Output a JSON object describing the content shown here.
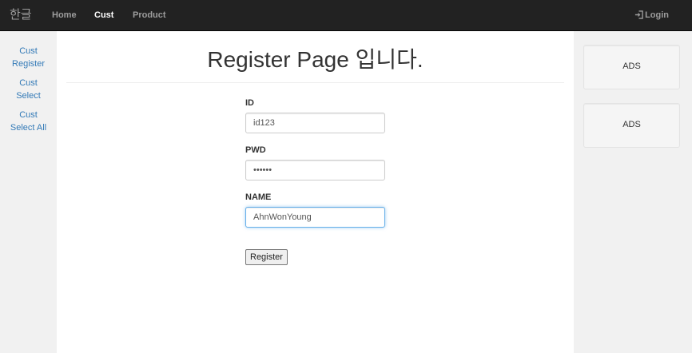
{
  "navbar": {
    "brand": "한글",
    "links": [
      {
        "label": "Home",
        "active": false
      },
      {
        "label": "Cust",
        "active": true
      },
      {
        "label": "Product",
        "active": false
      }
    ],
    "login_label": "Login",
    "login_icon": "log-in-icon"
  },
  "sidebar": {
    "items": [
      {
        "line1": "Cust",
        "line2": "Register"
      },
      {
        "line1": "Cust",
        "line2": "Select"
      },
      {
        "line1": "Cust",
        "line2": "Select All"
      }
    ]
  },
  "main": {
    "title": "Register Page 입니다.",
    "form": {
      "id_label": "ID",
      "id_value": "id123",
      "pwd_label": "PWD",
      "pwd_value": "••••••",
      "name_label": "NAME",
      "name_value": "AhnWonYoung",
      "submit_label": "Register"
    }
  },
  "ads": [
    {
      "label": "ADS"
    },
    {
      "label": "ADS"
    }
  ],
  "colors": {
    "navbar_bg": "#222222",
    "nav_text": "#9d9d9d",
    "nav_active": "#ffffff",
    "link": "#337ab7",
    "side_bg": "#f1f1f1",
    "focus_border": "#66afe9"
  }
}
